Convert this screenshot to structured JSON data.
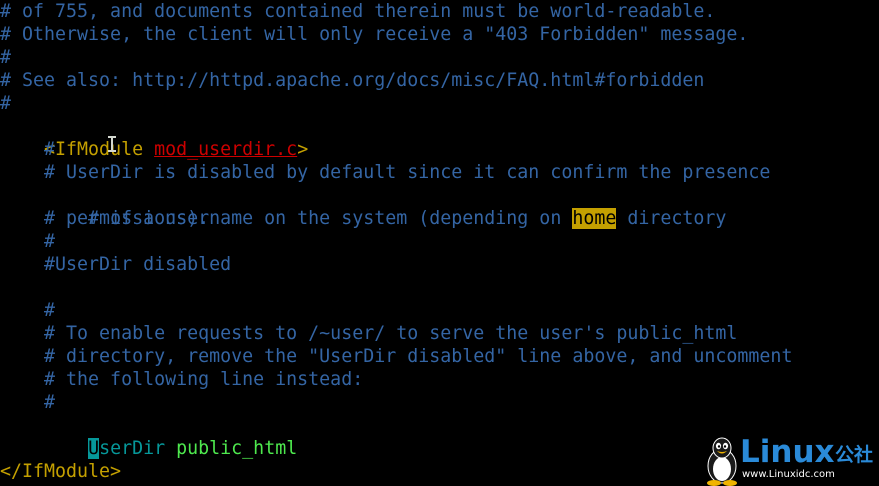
{
  "editor": {
    "lines": {
      "l1": "# of 755, and documents contained therein must be world-readable.",
      "l2": "# Otherwise, the client will only receive a \"403 Forbidden\" message.",
      "l3": "#",
      "l4": "# See also: http://httpd.apache.org/docs/misc/FAQ.html#forbidden",
      "l5": "#",
      "l6_open": "<IfModule ",
      "l6_module": "mod_userdir.c",
      "l6_close": ">",
      "l7": "    #",
      "l8": "    # UserDir is disabled by default since it can confirm the presence",
      "l9_before": "    # of a username on the system (depending on ",
      "l9_match": "home",
      "l9_after": " directory",
      "l10": "    # permissions).",
      "l11": "    #",
      "l12": "    #UserDir disabled",
      "l13": "",
      "l14": "    #",
      "l15": "    # To enable requests to /~user/ to serve the user's public_html",
      "l16": "    # directory, remove the \"UserDir disabled\" line above, and uncomment",
      "l17": "    # the following line instead:",
      "l18": "    #",
      "l19_indent": "    ",
      "l19_cursor_char": "U",
      "l19_keyword_rest": "serDir",
      "l19_space": " ",
      "l19_value": "public_html",
      "l20": "",
      "l21": "</IfModule>"
    },
    "search_term": "home",
    "colors": {
      "background": "#000000",
      "comment": "#3465a4",
      "tag": "#c4a000",
      "module_name": "#cc0000",
      "directive": "#06989a",
      "directive_value": "#4ee94e",
      "search_highlight": "#c4a000",
      "cursor": "#06989a"
    }
  },
  "watermark": {
    "name": "Linux",
    "name_cn": "公社",
    "url": "www.Linuxidc.com",
    "icon": "tux-penguin-icon"
  },
  "mouse_pointer": "text-ibeam-icon"
}
